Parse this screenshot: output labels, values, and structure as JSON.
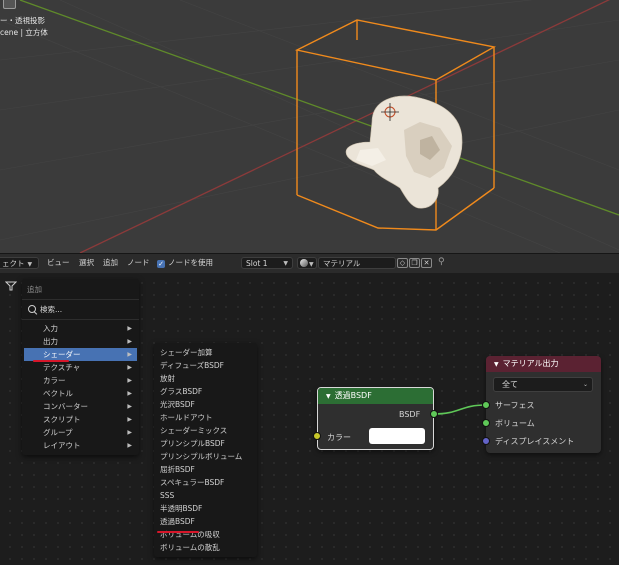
{
  "viewport": {
    "overlay_line1": "ー・透視投影",
    "overlay_line2": "cene | 立方体"
  },
  "header": {
    "editor_menu": "ェクト",
    "menus": [
      "ビュー",
      "選択",
      "追加",
      "ノード"
    ],
    "use_nodes_label": "ノードを使用",
    "use_nodes_checked": true,
    "slot": "Slot 1",
    "material_name": "マテリアル"
  },
  "add_menu": {
    "title": "追加",
    "search": "検索...",
    "items": [
      {
        "label": "入力",
        "active": false
      },
      {
        "label": "出力",
        "active": false
      },
      {
        "label": "シェーダー",
        "active": true
      },
      {
        "label": "テクスチャ",
        "active": false
      },
      {
        "label": "カラー",
        "active": false
      },
      {
        "label": "ベクトル",
        "active": false
      },
      {
        "label": "コンバーター",
        "active": false
      },
      {
        "label": "スクリプト",
        "active": false
      },
      {
        "label": "グループ",
        "active": false
      },
      {
        "label": "レイアウト",
        "active": false
      }
    ]
  },
  "shader_menu": {
    "items": [
      "シェーダー加算",
      "ディフューズBSDF",
      "放射",
      "グラスBSDF",
      "光沢BSDF",
      "ホールドアウト",
      "シェーダーミックス",
      "プリンシプルBSDF",
      "プリンシプルボリューム",
      "屈折BSDF",
      "スペキュラーBSDF",
      "SSS",
      "半透明BSDF",
      "透過BSDF",
      "ボリュームの吸収",
      "ボリュームの散乱"
    ],
    "underlined_item": "透過BSDF"
  },
  "nodes": {
    "transparent_bsdf": {
      "title": "透過BSDF",
      "output": "BSDF",
      "input_color": "カラー",
      "color_value": "#ffffff",
      "header_color": "#2c6e34"
    },
    "material_output": {
      "title": "マテリアル出力",
      "target": "全て",
      "inputs": [
        "サーフェス",
        "ボリューム",
        "ディスプレイスメント"
      ],
      "header_color": "#5b2232"
    }
  },
  "colors": {
    "accent": "#4772b3",
    "selection_outline": "#f08a1c",
    "annotation_red": "#d7162a"
  }
}
